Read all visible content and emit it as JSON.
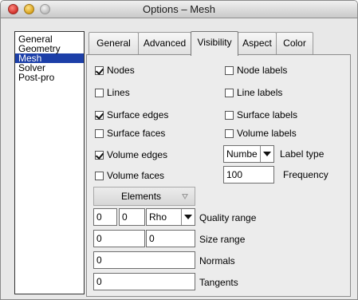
{
  "window": {
    "title": "Options – Mesh"
  },
  "sidebar": {
    "items": [
      {
        "label": "General",
        "selected": false
      },
      {
        "label": "Geometry",
        "selected": false
      },
      {
        "label": "Mesh",
        "selected": true
      },
      {
        "label": "Solver",
        "selected": false
      },
      {
        "label": "Post-pro",
        "selected": false
      }
    ]
  },
  "tabs": [
    {
      "label": "General",
      "active": false
    },
    {
      "label": "Advanced",
      "active": false
    },
    {
      "label": "Visibility",
      "active": true
    },
    {
      "label": "Aspect",
      "active": false
    },
    {
      "label": "Color",
      "active": false
    }
  ],
  "visibility": {
    "nodes": {
      "label": "Nodes",
      "checked": true
    },
    "lines": {
      "label": "Lines",
      "checked": false
    },
    "surface_edges": {
      "label": "Surface edges",
      "checked": true
    },
    "surface_faces": {
      "label": "Surface faces",
      "checked": false
    },
    "volume_edges": {
      "label": "Volume edges",
      "checked": true
    },
    "volume_faces": {
      "label": "Volume faces",
      "checked": false
    },
    "node_labels": {
      "label": "Node labels",
      "checked": false
    },
    "line_labels": {
      "label": "Line labels",
      "checked": false
    },
    "surface_labels": {
      "label": "Surface labels",
      "checked": false
    },
    "volume_labels": {
      "label": "Volume labels",
      "checked": false
    },
    "label_type": {
      "value": "Numbe",
      "label": "Label type"
    },
    "frequency": {
      "value": "100",
      "label": "Frequency"
    },
    "elements_button": {
      "label": "Elements"
    },
    "quality": {
      "min": "0",
      "max": "0",
      "measure": "Rho",
      "label": "Quality range"
    },
    "size": {
      "min": "0",
      "max": "0",
      "label": "Size range"
    },
    "normals": {
      "value": "0",
      "label": "Normals"
    },
    "tangents": {
      "value": "0",
      "label": "Tangents"
    }
  },
  "colors": {
    "selection": "#1c3fa8",
    "window_bg": "#e8e8e8",
    "close_light": "#d0302a",
    "minimize_light": "#d8a21c",
    "zoom_light": "#bcbcbc"
  }
}
